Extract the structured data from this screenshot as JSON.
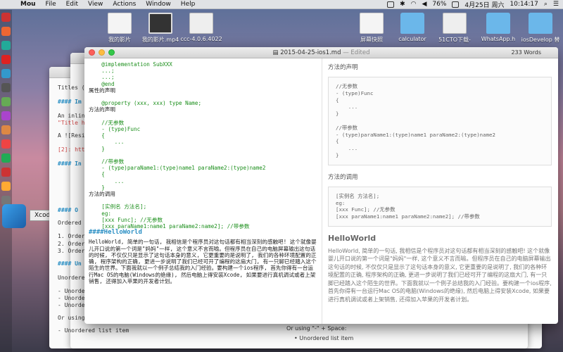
{
  "menubar": {
    "app": "Mou",
    "items": [
      "File",
      "Edit",
      "View",
      "Actions",
      "Window",
      "Help"
    ],
    "battery": "76%",
    "date": "4月25日 周六",
    "time": "10:14:17"
  },
  "desktop_icons": [
    {
      "label": "我的影片"
    },
    {
      "label": "我的影片.mp4"
    },
    {
      "label": "ccc-4.0.6.4022"
    },
    {
      "label": "屏幕快照"
    },
    {
      "label": "calculator"
    },
    {
      "label": "51CTO下载-"
    },
    {
      "label": "WhatsApp.h"
    },
    {
      "label": "iosDevelop 替"
    }
  ],
  "dock_tooltip": "Xcode",
  "back_window": {
    "lines": [
      "Titles (",
      "#### Im",
      "An inline",
      "\"Title he",
      "A ![Resiz",
      "[2]: http",
      "#### In",
      "#### O",
      "Ordered l",
      "1. Ordere",
      "2. Ordere",
      "3. Ordere",
      "#### Un",
      "Unordere",
      "- Unorder",
      "- Unorder",
      "- Unorder",
      "Or using \"-\" + Space:",
      "- Unordered list item"
    ]
  },
  "below_text": {
    "line1": "Or using \"-\" + Space:",
    "line2": "• Unordered list item"
  },
  "window": {
    "title": "2015-04-25-ios1.md",
    "edited": "— Edited",
    "word_count": "233 Words"
  },
  "editor": {
    "lines": [
      {
        "text": "    @implementation SubXXX",
        "cls": "g"
      },
      {
        "text": "    ...;",
        "cls": "g"
      },
      {
        "text": "    ...;",
        "cls": "g"
      },
      {
        "text": "    @end",
        "cls": "g"
      },
      {
        "text": "属性的声明",
        "cls": ""
      },
      {
        "text": "",
        "cls": ""
      },
      {
        "text": "    @property (xxx, xxx) type Name;",
        "cls": "g"
      },
      {
        "text": "方法的声明",
        "cls": ""
      },
      {
        "text": "",
        "cls": ""
      },
      {
        "text": "    //无参数",
        "cls": "g"
      },
      {
        "text": "    - (type)Func",
        "cls": "g"
      },
      {
        "text": "    {",
        "cls": "g"
      },
      {
        "text": "        ...",
        "cls": "g"
      },
      {
        "text": "    }",
        "cls": "g"
      },
      {
        "text": "",
        "cls": ""
      },
      {
        "text": "    //带参数",
        "cls": "g"
      },
      {
        "text": "    - (type)paraName1:(type)name1 paraName2:(type)name2",
        "cls": "g"
      },
      {
        "text": "    {",
        "cls": "g"
      },
      {
        "text": "        ...",
        "cls": "g"
      },
      {
        "text": "    }",
        "cls": "g"
      },
      {
        "text": "方法的调用",
        "cls": ""
      },
      {
        "text": "",
        "cls": ""
      },
      {
        "text": "    [实例名 方法名];",
        "cls": "g"
      },
      {
        "text": "    eg:",
        "cls": "g"
      },
      {
        "text": "    [xxx Func]; //无参数",
        "cls": "g"
      },
      {
        "text": "    [xxx paraName1:name1 paraName2:name2]; //带参数",
        "cls": "g"
      }
    ],
    "heading": "####HelloWorld",
    "paragraph": "HelloWorld, 简单的一句话, 我相信是个程序员对这句话都有相当深刻的感触吧! 这个就像婴儿开口说的第一个词是\"妈妈\"一样, 这个意义不言而喻。但程序员在自己的电脑屏幕输出这句话的时候, 不仅仅只是显示了这句话本身的意义, 它更重要的是说明了, 我们的各种环境配置的正确, 程序架构的正确, 更进一步说明了我们已经可开了编程的这扇大门, 有一只脚已经踏入这个陌生的世界。下面我就以一个例子总结我的入门经验。要构建一个ios程序, 首先你得有一台运行Mac OS的电脑(Windows的绝缘), 然后电脑上得安装Xcode, 如果要进行真机调试或者上架销售, 还得加入苹果的开发者计划。"
  },
  "preview": {
    "decl_heading": "方法的声明",
    "decl_code": "//无参数\n- (type)Func\n{\n    ...\n}\n\n//带参数\n- (type)paraName1:(type)name1 paraName2:(type)name2\n{\n    ...\n}",
    "call_heading": "方法的调用",
    "call_code": "[实例名 方法名];\neg:\n[xxx Func]; //无参数\n[xxx paraName1:name1 paraName2:name2]; //带参数",
    "h2": "HelloWorld",
    "paragraph": "HelloWorld, 简单的一句话, 我相信是个程序员对这句话都有相当深刻的感触吧! 这个就像婴儿开口说的第一个词是\"妈妈\"一样, 这个意义不言而喻。但程序员在自己的电脑屏幕输出这句话的时候, 不仅仅只是显示了这句话本身的意义, 它更重要的是说明了, 我们的各种环境配置的正确, 程序架构的正确, 更进一步说明了我们已经可开了编程的这扇大门, 有一只脚已经踏入这个陌生的世界。下面我就以一个例子总结我的入门经验。要构建一个ios程序, 首先你得有一台运行Mac OS的电脑(Windows的绝缘), 然后电脑上得安装Xcode, 如果要进行真机调试或者上架销售, 还得加入苹果的开发者计划。"
  }
}
